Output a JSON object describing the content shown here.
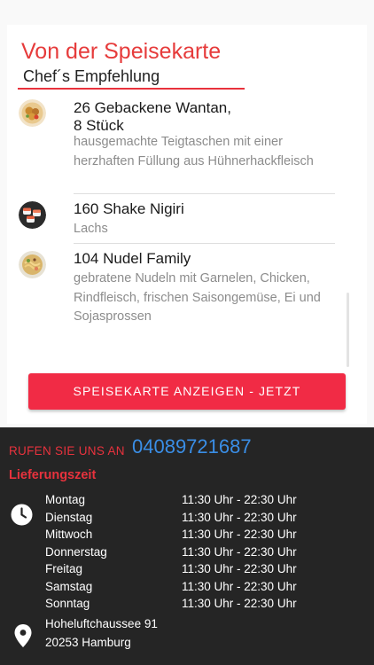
{
  "menu": {
    "title": "Von der Speisekarte",
    "subtitle": "Chef´s Empfehlung",
    "items": [
      {
        "title": "26 Gebackene Wantan,\n8 Stück",
        "description": "hausgemachte Teigtaschen mit einer herzhaften Füllung aus Hühnerhackfleisch"
      },
      {
        "title": "160 Shake Nigiri",
        "description": "Lachs"
      },
      {
        "title": "104 Nudel Family",
        "description": "gebratene Nudeln mit Garnelen, Chicken, Rindfleisch, frischen Saisongemüse, Ei und Sojasprossen"
      }
    ],
    "cta_label": "SPEISEKARTE ANZEIGEN - JETZT"
  },
  "contact": {
    "call_label": "RUFEN SIE UNS AN",
    "phone": "04089721687"
  },
  "hours": {
    "heading": "Lieferungszeit",
    "rows": [
      {
        "day": "Montag",
        "time": "11:30 Uhr - 22:30 Uhr"
      },
      {
        "day": "Dienstag",
        "time": "11:30 Uhr - 22:30 Uhr"
      },
      {
        "day": "Mittwoch",
        "time": "11:30 Uhr - 22:30 Uhr"
      },
      {
        "day": "Donnerstag",
        "time": "11:30 Uhr - 22:30 Uhr"
      },
      {
        "day": "Freitag",
        "time": "11:30 Uhr - 22:30 Uhr"
      },
      {
        "day": "Samstag",
        "time": "11:30 Uhr - 22:30 Uhr"
      },
      {
        "day": "Sonntag",
        "time": "11:30 Uhr - 22:30 Uhr"
      }
    ]
  },
  "address": {
    "street": "Hoheluftchaussee 91",
    "city": "20253 Hamburg"
  },
  "colors": {
    "accent_red": "#e8323d",
    "button_red": "#f12b45",
    "phone_blue": "#3a8ee6",
    "footer_bg": "#252525"
  },
  "icons": {
    "clock": "clock-icon",
    "location": "location-pin-icon"
  }
}
